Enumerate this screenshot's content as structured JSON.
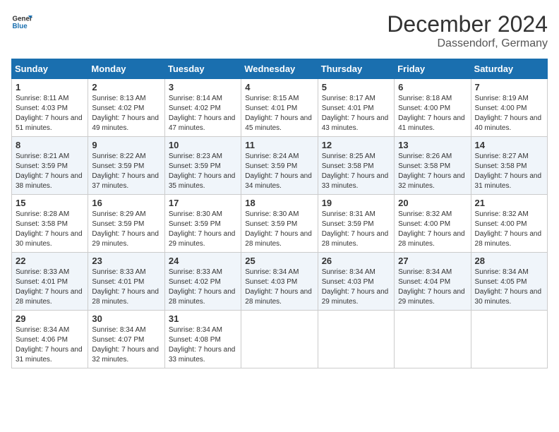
{
  "logo": {
    "text_general": "General",
    "text_blue": "Blue"
  },
  "title": "December 2024",
  "subtitle": "Dassendorf, Germany",
  "days_header": [
    "Sunday",
    "Monday",
    "Tuesday",
    "Wednesday",
    "Thursday",
    "Friday",
    "Saturday"
  ],
  "weeks": [
    [
      {
        "day": "1",
        "sunrise": "8:11 AM",
        "sunset": "4:03 PM",
        "daylight": "7 hours and 51 minutes."
      },
      {
        "day": "2",
        "sunrise": "8:13 AM",
        "sunset": "4:02 PM",
        "daylight": "7 hours and 49 minutes."
      },
      {
        "day": "3",
        "sunrise": "8:14 AM",
        "sunset": "4:02 PM",
        "daylight": "7 hours and 47 minutes."
      },
      {
        "day": "4",
        "sunrise": "8:15 AM",
        "sunset": "4:01 PM",
        "daylight": "7 hours and 45 minutes."
      },
      {
        "day": "5",
        "sunrise": "8:17 AM",
        "sunset": "4:01 PM",
        "daylight": "7 hours and 43 minutes."
      },
      {
        "day": "6",
        "sunrise": "8:18 AM",
        "sunset": "4:00 PM",
        "daylight": "7 hours and 41 minutes."
      },
      {
        "day": "7",
        "sunrise": "8:19 AM",
        "sunset": "4:00 PM",
        "daylight": "7 hours and 40 minutes."
      }
    ],
    [
      {
        "day": "8",
        "sunrise": "8:21 AM",
        "sunset": "3:59 PM",
        "daylight": "7 hours and 38 minutes."
      },
      {
        "day": "9",
        "sunrise": "8:22 AM",
        "sunset": "3:59 PM",
        "daylight": "7 hours and 37 minutes."
      },
      {
        "day": "10",
        "sunrise": "8:23 AM",
        "sunset": "3:59 PM",
        "daylight": "7 hours and 35 minutes."
      },
      {
        "day": "11",
        "sunrise": "8:24 AM",
        "sunset": "3:59 PM",
        "daylight": "7 hours and 34 minutes."
      },
      {
        "day": "12",
        "sunrise": "8:25 AM",
        "sunset": "3:58 PM",
        "daylight": "7 hours and 33 minutes."
      },
      {
        "day": "13",
        "sunrise": "8:26 AM",
        "sunset": "3:58 PM",
        "daylight": "7 hours and 32 minutes."
      },
      {
        "day": "14",
        "sunrise": "8:27 AM",
        "sunset": "3:58 PM",
        "daylight": "7 hours and 31 minutes."
      }
    ],
    [
      {
        "day": "15",
        "sunrise": "8:28 AM",
        "sunset": "3:58 PM",
        "daylight": "7 hours and 30 minutes."
      },
      {
        "day": "16",
        "sunrise": "8:29 AM",
        "sunset": "3:59 PM",
        "daylight": "7 hours and 29 minutes."
      },
      {
        "day": "17",
        "sunrise": "8:30 AM",
        "sunset": "3:59 PM",
        "daylight": "7 hours and 29 minutes."
      },
      {
        "day": "18",
        "sunrise": "8:30 AM",
        "sunset": "3:59 PM",
        "daylight": "7 hours and 28 minutes."
      },
      {
        "day": "19",
        "sunrise": "8:31 AM",
        "sunset": "3:59 PM",
        "daylight": "7 hours and 28 minutes."
      },
      {
        "day": "20",
        "sunrise": "8:32 AM",
        "sunset": "4:00 PM",
        "daylight": "7 hours and 28 minutes."
      },
      {
        "day": "21",
        "sunrise": "8:32 AM",
        "sunset": "4:00 PM",
        "daylight": "7 hours and 28 minutes."
      }
    ],
    [
      {
        "day": "22",
        "sunrise": "8:33 AM",
        "sunset": "4:01 PM",
        "daylight": "7 hours and 28 minutes."
      },
      {
        "day": "23",
        "sunrise": "8:33 AM",
        "sunset": "4:01 PM",
        "daylight": "7 hours and 28 minutes."
      },
      {
        "day": "24",
        "sunrise": "8:33 AM",
        "sunset": "4:02 PM",
        "daylight": "7 hours and 28 minutes."
      },
      {
        "day": "25",
        "sunrise": "8:34 AM",
        "sunset": "4:03 PM",
        "daylight": "7 hours and 28 minutes."
      },
      {
        "day": "26",
        "sunrise": "8:34 AM",
        "sunset": "4:03 PM",
        "daylight": "7 hours and 29 minutes."
      },
      {
        "day": "27",
        "sunrise": "8:34 AM",
        "sunset": "4:04 PM",
        "daylight": "7 hours and 29 minutes."
      },
      {
        "day": "28",
        "sunrise": "8:34 AM",
        "sunset": "4:05 PM",
        "daylight": "7 hours and 30 minutes."
      }
    ],
    [
      {
        "day": "29",
        "sunrise": "8:34 AM",
        "sunset": "4:06 PM",
        "daylight": "7 hours and 31 minutes."
      },
      {
        "day": "30",
        "sunrise": "8:34 AM",
        "sunset": "4:07 PM",
        "daylight": "7 hours and 32 minutes."
      },
      {
        "day": "31",
        "sunrise": "8:34 AM",
        "sunset": "4:08 PM",
        "daylight": "7 hours and 33 minutes."
      },
      null,
      null,
      null,
      null
    ]
  ]
}
